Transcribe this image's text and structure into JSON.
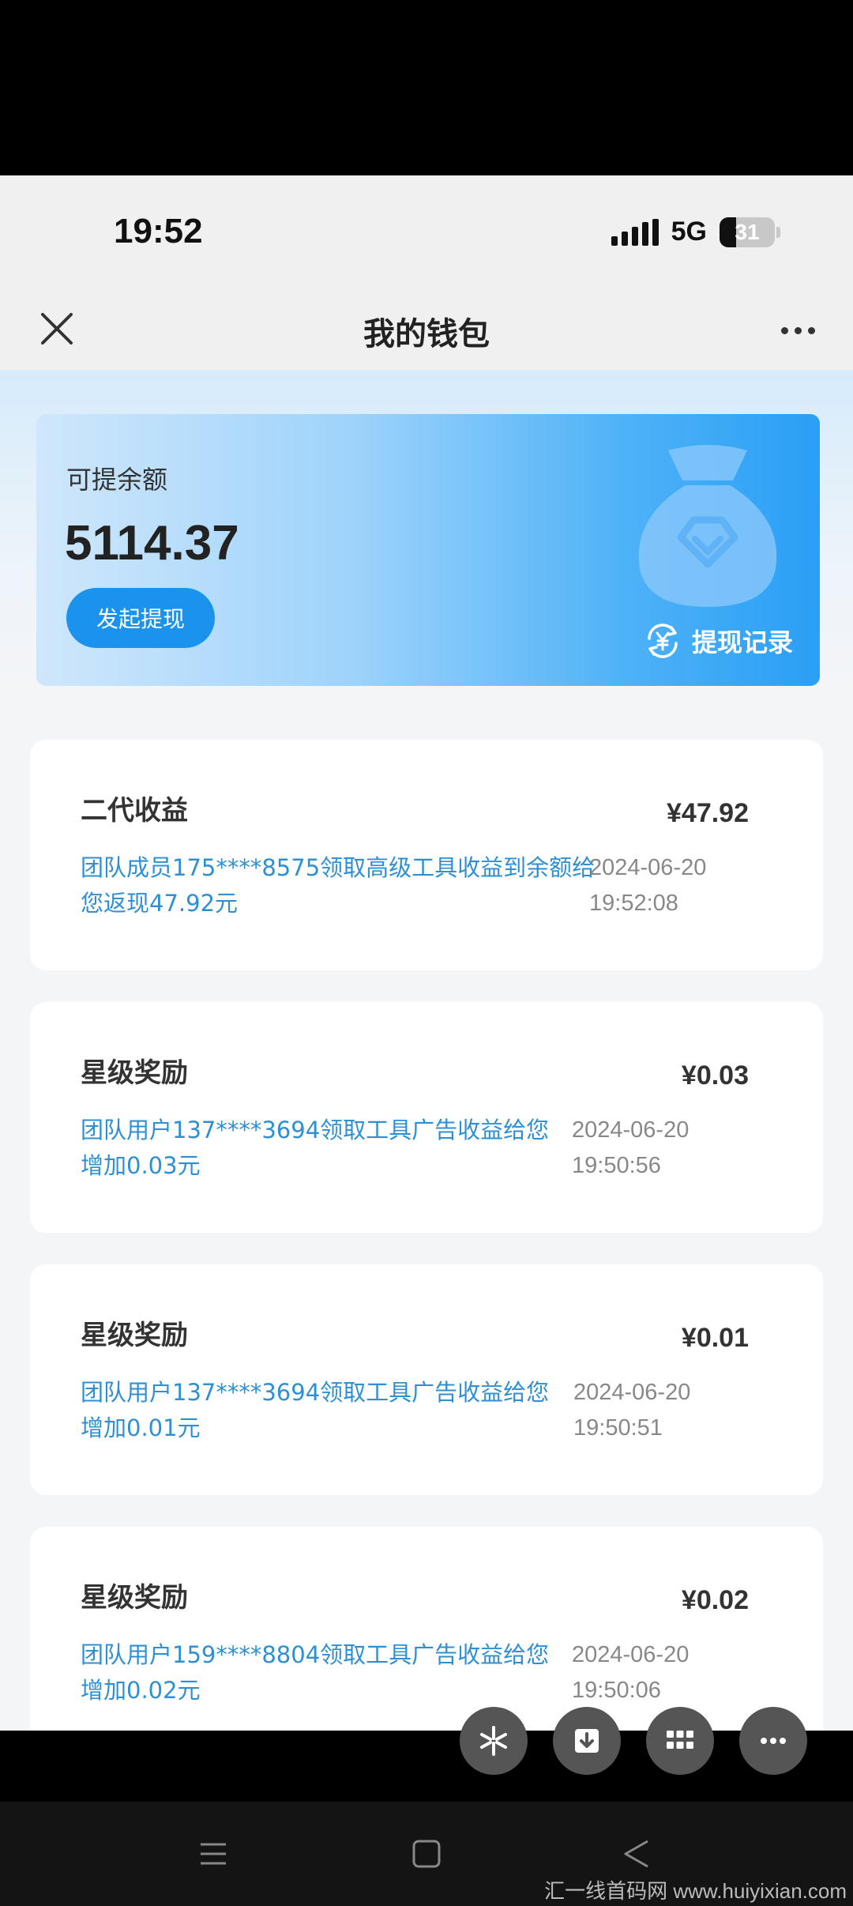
{
  "status_bar": {
    "time": "19:52",
    "network": "5G",
    "battery": "31"
  },
  "nav": {
    "title": "我的钱包"
  },
  "wallet": {
    "balance_label": "可提余额",
    "balance": "5114.37",
    "withdraw_button": "发起提现",
    "records_link": "提现记录"
  },
  "transactions": [
    {
      "title": "二代收益",
      "amount": "¥47.92",
      "desc": "团队成员175****8575领取高级工具收益到余额给您返现47.92元",
      "date": "2024-06-20",
      "time": "19:52:08"
    },
    {
      "title": "星级奖励",
      "amount": "¥0.03",
      "desc": "团队用户137****3694领取工具广告收益给您增加0.03元",
      "date": "2024-06-20",
      "time": "19:50:56"
    },
    {
      "title": "星级奖励",
      "amount": "¥0.01",
      "desc": "团队用户137****3694领取工具广告收益给您增加0.01元",
      "date": "2024-06-20",
      "time": "19:50:51"
    },
    {
      "title": "星级奖励",
      "amount": "¥0.02",
      "desc": "团队用户159****8804领取工具广告收益给您增加0.02元",
      "date": "2024-06-20",
      "time": "19:50:06"
    }
  ],
  "floating_actions": [
    "sparkle-icon",
    "download-icon",
    "grid-icon",
    "more-icon"
  ],
  "watermark": "汇一线首码网 www.huiyixian.com",
  "colors": {
    "accent": "#1a93ee",
    "link_text": "#2f8fd3",
    "card_gradient_end": "#2a9ff6"
  }
}
